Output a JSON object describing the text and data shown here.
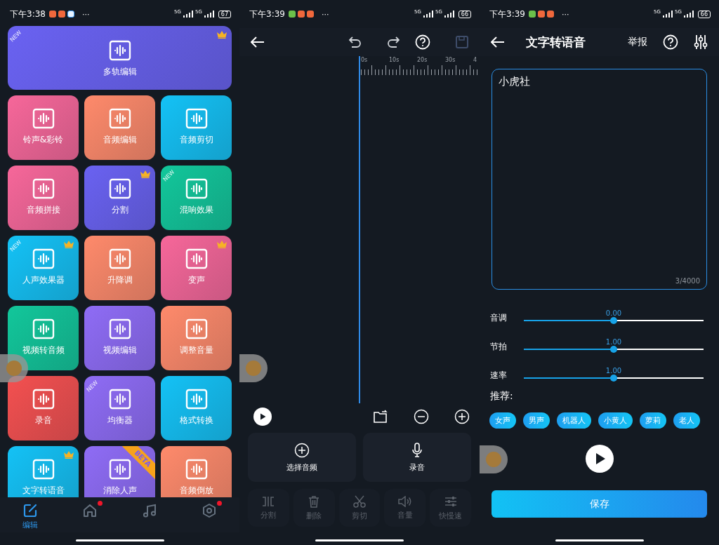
{
  "screens": [
    {
      "status_bar": {
        "time": "下午3:38",
        "more": "···",
        "net_1": "5G",
        "net_2": "5G",
        "battery": "67"
      },
      "feature_grid": [
        {
          "label": "多轨编辑",
          "color": "#6a62f2",
          "new_label": "NEW",
          "crown": true,
          "wide": true
        },
        {
          "label": "铃声&彩铃",
          "color": "#f7679a",
          "crown": false,
          "wide": false
        },
        {
          "label": "音频编辑",
          "color": "#ff8a6b",
          "crown": false,
          "wide": false
        },
        {
          "label": "音频剪切",
          "color": "#14c2f6",
          "crown": false,
          "wide": false
        },
        {
          "label": "音频拼接",
          "color": "#f7679a",
          "crown": false,
          "wide": false
        },
        {
          "label": "分割",
          "color": "#6a62f2",
          "crown": true,
          "wide": false
        },
        {
          "label": "混响效果",
          "color": "#12c79b",
          "new_label": "NEW",
          "crown": false,
          "wide": false
        },
        {
          "label": "人声效果器",
          "color": "#14c2f6",
          "new_label": "NEW",
          "crown": true,
          "wide": false
        },
        {
          "label": "升降调",
          "color": "#ff8a6b",
          "crown": false,
          "wide": false
        },
        {
          "label": "变声",
          "color": "#f7679a",
          "crown": true,
          "wide": false
        },
        {
          "label": "视频转音频",
          "color": "#12c79b",
          "crown": false,
          "wide": false
        },
        {
          "label": "视频编辑",
          "color": "#8f6cf6",
          "crown": false,
          "wide": false
        },
        {
          "label": "调整音量",
          "color": "#ff8a6b",
          "crown": false,
          "wide": false
        },
        {
          "label": "录音",
          "color": "#f45050",
          "crown": false,
          "wide": false
        },
        {
          "label": "均衡器",
          "color": "#8f6cf6",
          "new_label": "NEW",
          "crown": false,
          "wide": false
        },
        {
          "label": "格式转换",
          "color": "#14c2f6",
          "crown": false,
          "wide": false
        },
        {
          "label": "文字转语音",
          "color": "#14c2f6",
          "crown": true,
          "wide": false
        },
        {
          "label": "消除人声",
          "color": "#8f6cf6",
          "beta_label": "BETA",
          "crown": false,
          "wide": false
        },
        {
          "label": "音频倒放",
          "color": "#ff8a6b",
          "crown": false,
          "wide": false
        }
      ],
      "bottom_nav": [
        {
          "label": "编辑",
          "kind": "edit",
          "selected": true,
          "badge": false
        },
        {
          "kind": "home",
          "selected": false,
          "badge": true
        },
        {
          "kind": "music",
          "selected": false,
          "badge": false
        },
        {
          "kind": "settings",
          "selected": false,
          "badge": true
        }
      ]
    },
    {
      "status_bar": {
        "time": "下午3:39",
        "more": "···",
        "net_1": "5G",
        "net_2": "5G",
        "battery": "66"
      },
      "ruler_labels": [
        "0s",
        "10s",
        "20s",
        "30s",
        "4"
      ],
      "actions": [
        {
          "label": "选择音频",
          "kind": "add"
        },
        {
          "label": "录音",
          "kind": "mic"
        }
      ],
      "tools": [
        {
          "label": "分割",
          "kind": "split",
          "disabled": true
        },
        {
          "label": "删除",
          "kind": "delete",
          "disabled": true
        },
        {
          "label": "剪切",
          "kind": "cut",
          "disabled": true
        },
        {
          "label": "音量",
          "kind": "volume",
          "disabled": true
        },
        {
          "label": "快慢速",
          "kind": "speed",
          "disabled": true
        }
      ]
    },
    {
      "status_bar": {
        "time": "下午3:39",
        "more": "···",
        "net_1": "5G",
        "net_2": "5G",
        "battery": "66"
      },
      "title": "文字转语音",
      "report": "举报",
      "text_input": {
        "value": "小虎社",
        "counter": "3/4000"
      },
      "sliders": [
        {
          "label": "音调",
          "reading": "0.00",
          "level": 0.5
        },
        {
          "label": "节拍",
          "reading": "1.00",
          "level": 0.5
        },
        {
          "label": "速率",
          "reading": "1.00",
          "level": 0.5
        }
      ],
      "recommend_label": "推荐:",
      "voices": [
        "女声",
        "男声",
        "机器人",
        "小黄人",
        "萝莉",
        "老人"
      ],
      "save": "保存"
    }
  ]
}
